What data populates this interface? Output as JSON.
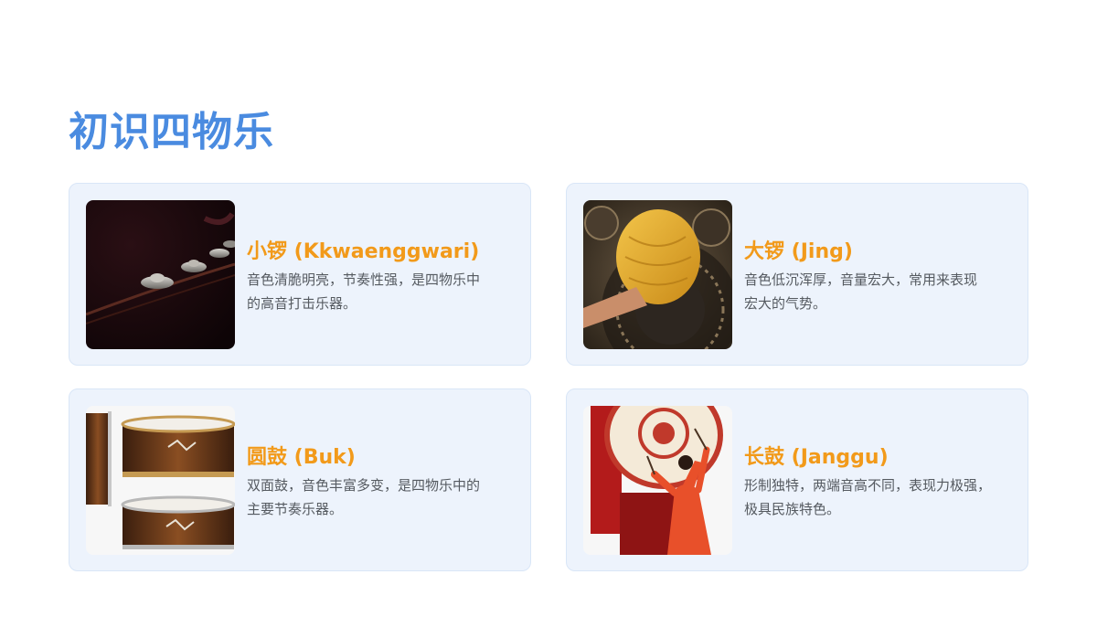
{
  "page": {
    "title": "初识四物乐"
  },
  "cards": [
    {
      "title": "小锣 (Kkwaenggwari)",
      "desc": "音色清脆明亮，节奏性强，是四物乐中\n的高音打击乐器。",
      "icon": "small-gong-photo"
    },
    {
      "title": "大锣 (Jing)",
      "desc": "音色低沉浑厚，音量宏大，常用来表现\n宏大的气势。",
      "icon": "large-gong-photo"
    },
    {
      "title": "圆鼓 (Buk)",
      "desc": "双面鼓，音色丰富多变，是四物乐中的\n主要节奏乐器。",
      "icon": "barrel-drum-photo"
    },
    {
      "title": "长鼓 (Janggu)",
      "desc": "形制独特，两端音高不同，表现力极强，\n极具民族特色。",
      "icon": "hourglass-drum-photo"
    }
  ],
  "colors": {
    "title": "#4a8be0",
    "card_title": "#f29a1a",
    "card_bg": "#edf3fc"
  }
}
